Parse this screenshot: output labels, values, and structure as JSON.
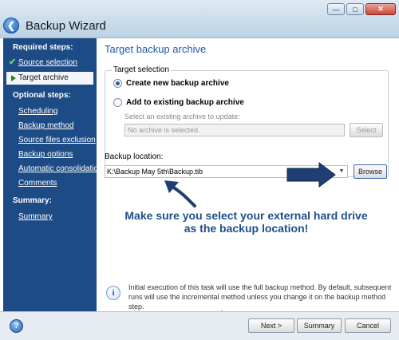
{
  "window": {
    "title": "Backup Wizard"
  },
  "sidebar": {
    "required_heading": "Required steps:",
    "optional_heading": "Optional steps:",
    "summary_heading": "Summary:",
    "items": [
      {
        "label": "Source selection"
      },
      {
        "label": "Target archive"
      },
      {
        "label": "Scheduling"
      },
      {
        "label": "Backup method"
      },
      {
        "label": "Source files exclusion"
      },
      {
        "label": "Backup options"
      },
      {
        "label": "Automatic consolidation"
      },
      {
        "label": "Comments"
      },
      {
        "label": "Summary"
      }
    ]
  },
  "main": {
    "title": "Target backup archive",
    "target_selection": {
      "legend": "Target selection",
      "create_label": "Create new backup archive",
      "add_label": "Add to existing backup archive",
      "select_existing_label": "Select an existing archive to update:",
      "no_archive_text": "No archive is selected.",
      "select_button": "Select"
    },
    "backup_location": {
      "label": "Backup location:",
      "value": "K:\\Backup May 5th\\Backup.tib",
      "browse_button": "Browse"
    },
    "annotation": {
      "line1": "Make sure you select your external hard drive",
      "line2": "as the backup location!"
    },
    "info_text": "Initial execution of this task will use the full backup method. By default, subsequent runs will use the incremental method unless you change it on the backup method step."
  },
  "footer": {
    "next_button": "Next >",
    "summary_button": "Summary",
    "cancel_button": "Cancel"
  },
  "colors": {
    "sidebar_bg": "#1d4b85",
    "title_blue": "#1e5aa8",
    "annotation_arrow": "#1f3f73"
  },
  "icons": {
    "back": "back-arrow-icon",
    "check": "checkmark-icon",
    "current_step": "current-step-arrow-icon",
    "info": "info-icon",
    "help": "help-icon"
  }
}
